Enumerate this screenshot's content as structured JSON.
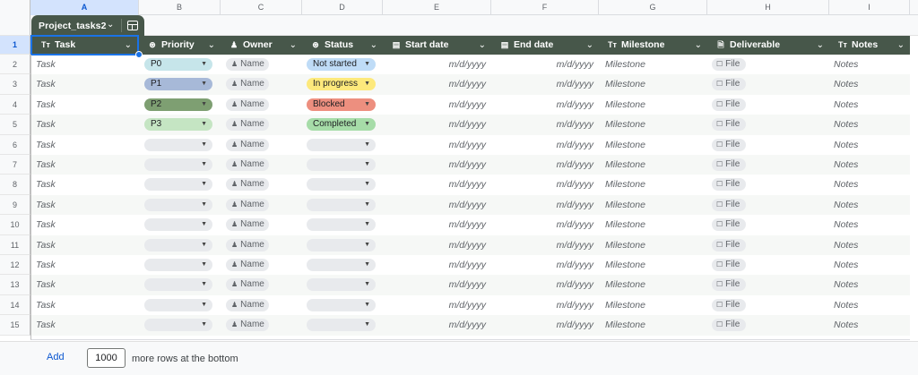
{
  "column_letters": [
    "A",
    "B",
    "C",
    "D",
    "E",
    "F",
    "G",
    "H",
    "I"
  ],
  "table": {
    "name": "Project_tasks2"
  },
  "headers": [
    {
      "label": "Task",
      "icon": "text-type-icon"
    },
    {
      "label": "Priority",
      "icon": "dropdown-chip-icon"
    },
    {
      "label": "Owner",
      "icon": "person-icon"
    },
    {
      "label": "Status",
      "icon": "dropdown-chip-icon"
    },
    {
      "label": "Start date",
      "icon": "calendar-icon"
    },
    {
      "label": "End date",
      "icon": "calendar-icon"
    },
    {
      "label": "Milestone",
      "icon": "text-type-icon"
    },
    {
      "label": "Deliverable",
      "icon": "file-icon"
    },
    {
      "label": "Notes",
      "icon": "text-type-icon"
    }
  ],
  "row_numbers": [
    "1",
    "2",
    "3",
    "4",
    "5",
    "6",
    "7",
    "8",
    "9",
    "10",
    "11",
    "12",
    "13",
    "14",
    "15"
  ],
  "placeholders": {
    "task": "Task",
    "owner": "Name",
    "date": "m/d/yyyy",
    "milestone": "Milestone",
    "deliverable": "File",
    "notes": "Notes"
  },
  "priority_chips": [
    {
      "label": "P0",
      "color": "#c6e5ea"
    },
    {
      "label": "P1",
      "color": "#a7b9d8"
    },
    {
      "label": "P2",
      "color": "#7e9f72"
    },
    {
      "label": "P3",
      "color": "#c5e5c3"
    }
  ],
  "status_chips": [
    {
      "label": "Not started",
      "color": "#bfdcf7"
    },
    {
      "label": "In progress",
      "color": "#fde97c"
    },
    {
      "label": "Blocked",
      "color": "#ed8f7f"
    },
    {
      "label": "Completed",
      "color": "#a6dca8"
    }
  ],
  "empty_chip_color": "#e8eaed",
  "header_color": "#47574a",
  "footer": {
    "add_label": "Add",
    "row_count": "1000",
    "suffix": "more rows at the bottom"
  }
}
